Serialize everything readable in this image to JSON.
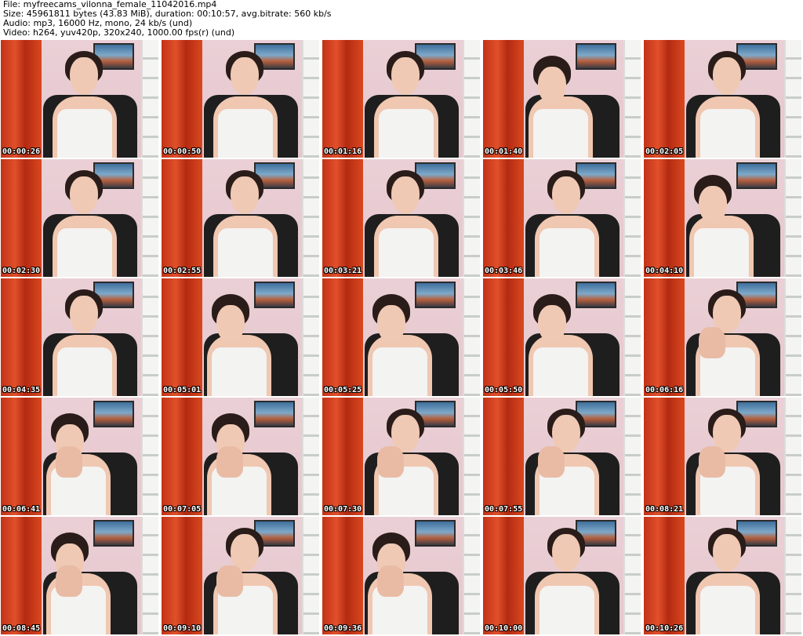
{
  "header": {
    "file_line": "File: myfreecams_vilonna_female_11042016.mp4",
    "size_line": "Size: 45961811 bytes (43.83 MiB), duration: 00:10:57, avg.bitrate: 560 kb/s",
    "audio_line": "Audio: mp3, 16000 Hz, mono, 24 kb/s (und)",
    "video_line": "Video: h264, yuv420p, 320x240, 1000.00 fps(r) (und)"
  },
  "thumbnails": [
    {
      "timestamp": "00:00:26"
    },
    {
      "timestamp": "00:00:50"
    },
    {
      "timestamp": "00:01:16"
    },
    {
      "timestamp": "00:01:40"
    },
    {
      "timestamp": "00:02:05"
    },
    {
      "timestamp": "00:02:30"
    },
    {
      "timestamp": "00:02:55"
    },
    {
      "timestamp": "00:03:21"
    },
    {
      "timestamp": "00:03:46"
    },
    {
      "timestamp": "00:04:10"
    },
    {
      "timestamp": "00:04:35"
    },
    {
      "timestamp": "00:05:01"
    },
    {
      "timestamp": "00:05:25"
    },
    {
      "timestamp": "00:05:50"
    },
    {
      "timestamp": "00:06:16"
    },
    {
      "timestamp": "00:06:41"
    },
    {
      "timestamp": "00:07:05"
    },
    {
      "timestamp": "00:07:30"
    },
    {
      "timestamp": "00:07:55"
    },
    {
      "timestamp": "00:08:21"
    },
    {
      "timestamp": "00:08:45"
    },
    {
      "timestamp": "00:09:10"
    },
    {
      "timestamp": "00:09:36"
    },
    {
      "timestamp": "00:10:00"
    },
    {
      "timestamp": "00:10:26"
    }
  ],
  "colors": {
    "curtain": "#c23217",
    "wall": "#e6c6cd",
    "timestamp_text": "#ffffff",
    "header_text": "#000000"
  }
}
